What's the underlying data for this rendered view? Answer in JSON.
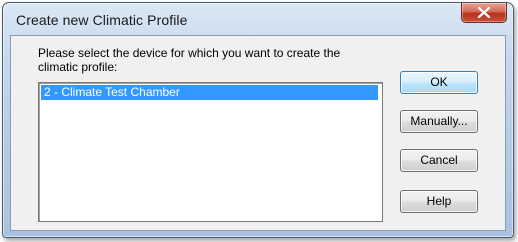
{
  "window": {
    "title": "Create new Climatic Profile"
  },
  "prompt": {
    "text": "Please select the device for which you want to create the climatic profile:"
  },
  "device_list": {
    "items": [
      "2 - Climate Test Chamber"
    ],
    "selected_index": 0
  },
  "buttons": {
    "ok": "OK",
    "manually": "Manually...",
    "cancel": "Cancel",
    "help": "Help"
  },
  "colors": {
    "selection": "#3399ff",
    "close_button": "#c9503a",
    "title_bar": "#c6d9ee"
  },
  "icons": {
    "close": "close-icon"
  }
}
